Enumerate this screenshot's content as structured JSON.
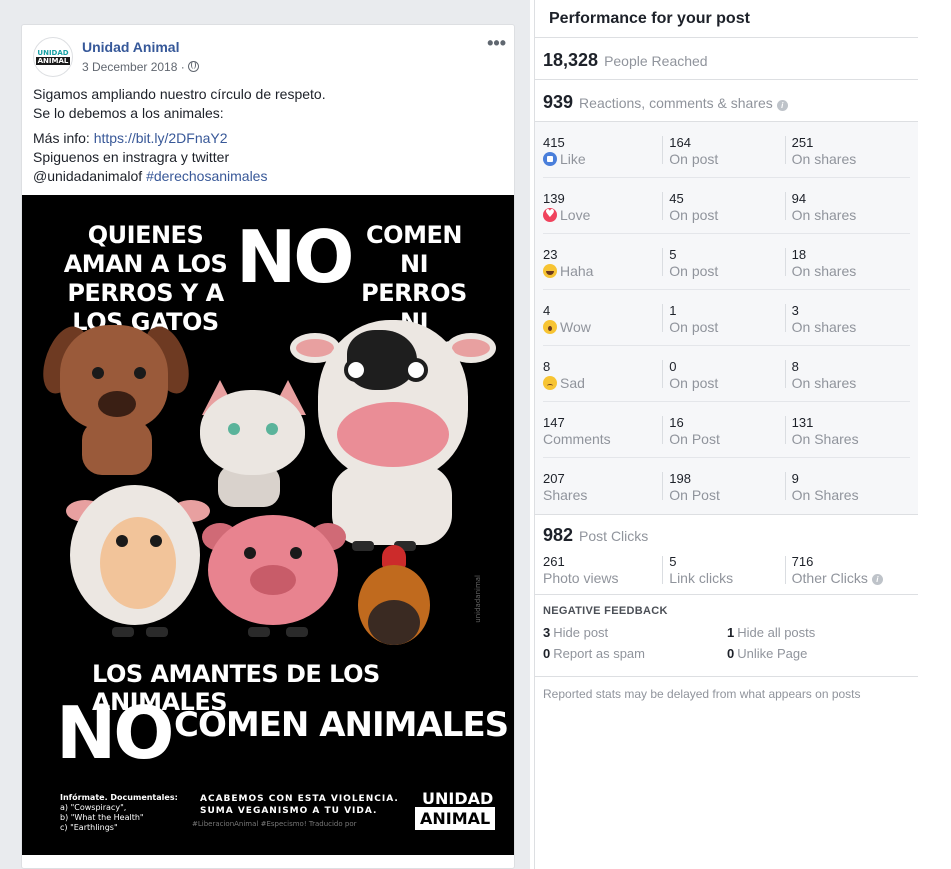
{
  "post": {
    "page_name": "Unidad Animal",
    "date": "3 December 2018 ·",
    "avatar_top": "UNIDAD",
    "avatar_bottom": "ANIMAL",
    "more": "•••",
    "line1": "Sigamos ampliando nuestro círculo de respeto.",
    "line2": "Se lo debemos a los animales:",
    "info_prefix": "Más info: ",
    "info_link": "https://bit.ly/2DFnaY2",
    "follow": "Spiguenos en instragra y twitter",
    "handle": "@unidadanimalof ",
    "hashtag": "#derechosanimales"
  },
  "poster": {
    "quote_left": "QUIENES AMAN A LOS PERROS Y A LOS GATOS",
    "no": "NO",
    "quote_right": "COMEN NI PERROS NI GATOS",
    "bottom_line": "LOS AMANTES DE LOS ANIMALES",
    "bottom_main": "COMEN ANIMALES",
    "docs_title": "Infórmate. Documentales:",
    "docs_a": "a) \"Cowspiracy\",",
    "docs_b": "b) \"What the Health\"",
    "docs_c": "c) \"Earthlings\"",
    "slogan1": "ACABEMOS CON ESTA VIOLENCIA.",
    "slogan2": "SUMA VEGANISMO A TU VIDA.",
    "hashtags": "#LiberacionAnimal #Especismo!   Traducido por",
    "logo_top": "UNIDAD",
    "logo_bottom": "ANIMAL",
    "side": "unidadanimal"
  },
  "panel": {
    "title": "Performance for your post",
    "reached_num": "18,328",
    "reached_label": "People Reached",
    "rcs_num": "939",
    "rcs_label": "Reactions, comments & shares",
    "rows": [
      {
        "icon": "like-icon",
        "total": "415",
        "label": "Like",
        "on_post": "164",
        "on_post_label": "On post",
        "on_shares": "251",
        "on_shares_label": "On shares"
      },
      {
        "icon": "love-icon",
        "total": "139",
        "label": "Love",
        "on_post": "45",
        "on_post_label": "On post",
        "on_shares": "94",
        "on_shares_label": "On shares"
      },
      {
        "icon": "haha-icon",
        "total": "23",
        "label": "Haha",
        "on_post": "5",
        "on_post_label": "On post",
        "on_shares": "18",
        "on_shares_label": "On shares"
      },
      {
        "icon": "wow-icon",
        "total": "4",
        "label": "Wow",
        "on_post": "1",
        "on_post_label": "On post",
        "on_shares": "3",
        "on_shares_label": "On shares"
      },
      {
        "icon": "sad-icon",
        "total": "8",
        "label": "Sad",
        "on_post": "0",
        "on_post_label": "On post",
        "on_shares": "8",
        "on_shares_label": "On shares"
      },
      {
        "icon": "",
        "total": "147",
        "label": "Comments",
        "on_post": "16",
        "on_post_label": "On Post",
        "on_shares": "131",
        "on_shares_label": "On Shares"
      },
      {
        "icon": "",
        "total": "207",
        "label": "Shares",
        "on_post": "198",
        "on_post_label": "On Post",
        "on_shares": "9",
        "on_shares_label": "On Shares"
      }
    ],
    "clicks_num": "982",
    "clicks_label": "Post Clicks",
    "photo_views_num": "261",
    "photo_views_label": "Photo views",
    "link_clicks_num": "5",
    "link_clicks_label": "Link clicks",
    "other_clicks_num": "716",
    "other_clicks_label": "Other Clicks",
    "neg_title": "NEGATIVE FEEDBACK",
    "hide_post_num": "3",
    "hide_post_label": "Hide post",
    "hide_all_num": "1",
    "hide_all_label": "Hide all posts",
    "spam_num": "0",
    "spam_label": "Report as spam",
    "unlike_num": "0",
    "unlike_label": "Unlike Page",
    "note": "Reported stats may be delayed from what appears on posts"
  }
}
